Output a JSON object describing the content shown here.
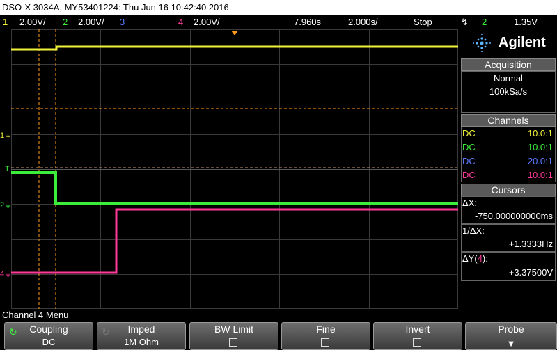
{
  "title": "DSO-X 3034A, MY53401224: Thu Jun 16 10:42:40 2016",
  "status": {
    "ch1_num": "1",
    "ch1_scale": "2.00V/",
    "ch2_num": "2",
    "ch2_scale": "2.00V/",
    "ch3_num": "3",
    "ch4_num": "4",
    "ch4_scale": "2.00V/",
    "time_pos": "7.960s",
    "time_scale": "2.000s/",
    "run_state": "Stop",
    "trig_icon": "↯",
    "trig_src": "2",
    "trig_level": "1.35V"
  },
  "brand": {
    "name": "Agilent",
    "logo_icon": "spark-icon"
  },
  "acquisition": {
    "header": "Acquisition",
    "mode": "Normal",
    "rate": "100kSa/s"
  },
  "channels": {
    "header": "Channels",
    "rows": [
      {
        "coupling": "DC",
        "probe": "10.0:1",
        "color": "#f2f23a"
      },
      {
        "coupling": "DC",
        "probe": "10.0:1",
        "color": "#3aee3a"
      },
      {
        "coupling": "DC",
        "probe": "20.0:1",
        "color": "#5a7aff"
      },
      {
        "coupling": "DC",
        "probe": "10.0:1",
        "color": "#ff3a9a"
      }
    ]
  },
  "cursors": {
    "header": "Cursors",
    "dx_label": "ΔX:",
    "dx_value": "-750.000000000ms",
    "inv_label": "1/ΔX:",
    "inv_value": "+1.3333Hz",
    "dy_label_pre": "ΔY(",
    "dy_channel": "4",
    "dy_label_post": "):",
    "dy_value": "+3.37500V"
  },
  "markers": {
    "ch1": "1",
    "trig": "T",
    "ch2": "2",
    "ch4": "4"
  },
  "menu": {
    "title": "Channel 4 Menu",
    "keys": [
      {
        "label": "Coupling",
        "value": "DC"
      },
      {
        "label": "Imped",
        "value": "1M Ohm"
      },
      {
        "label": "BW Limit"
      },
      {
        "label": "Fine"
      },
      {
        "label": "Invert"
      },
      {
        "label": "Probe"
      }
    ]
  },
  "colors": {
    "ch1": "#f2f23a",
    "ch2": "#3aee3a",
    "ch3": "#5a7aff",
    "ch4": "#ff3a9a",
    "cursor": "#ff9a1a",
    "grid": "#3a3a3a"
  }
}
